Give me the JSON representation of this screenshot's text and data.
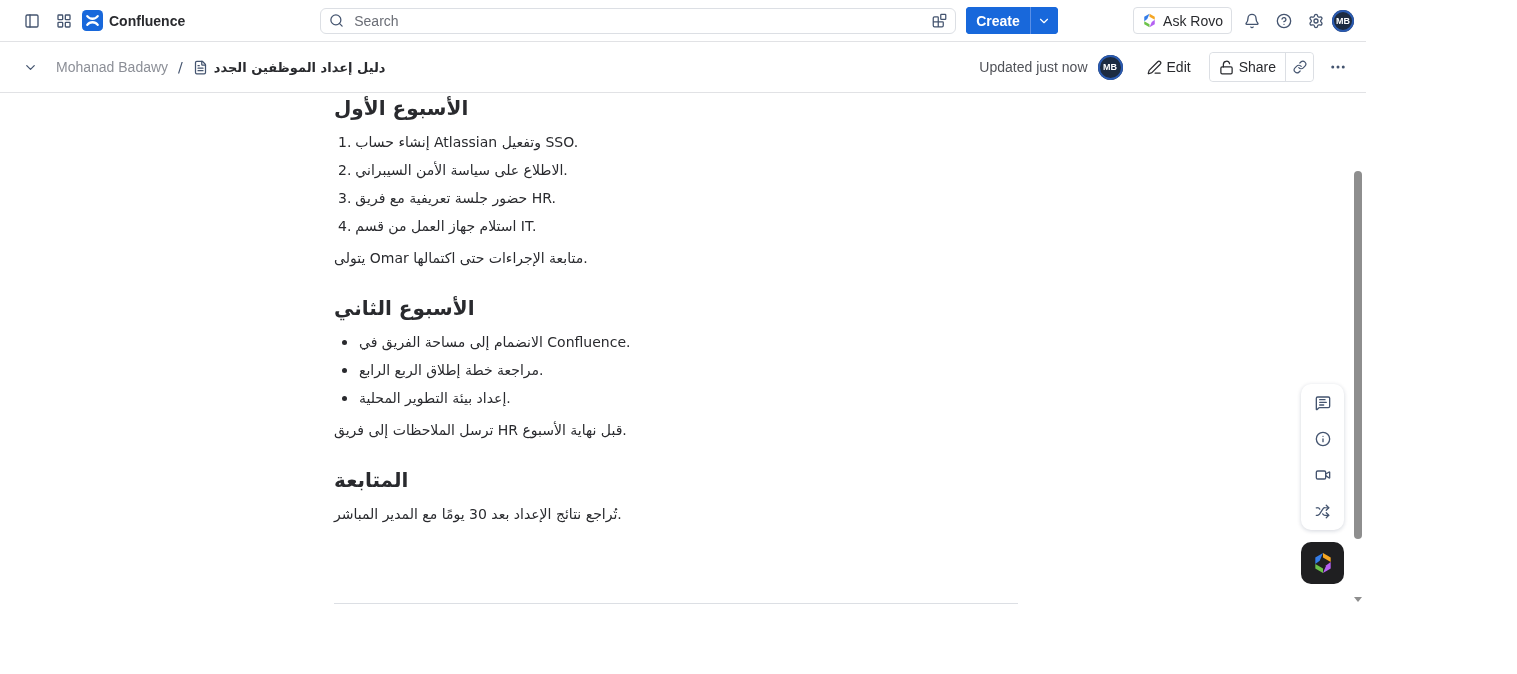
{
  "topbar": {
    "app_name": "Confluence",
    "search": {
      "placeholder": "Search"
    },
    "create_label": "Create",
    "ask_rovo_label": "Ask Rovo",
    "avatar_initials": "MB"
  },
  "page_bar": {
    "breadcrumb_space": "Mohanad Badawy",
    "breadcrumb_separator": "/",
    "page_title": "دليل إعداد الموظفين الجدد",
    "updated": "Updated just now",
    "avatar_initials": "MB",
    "edit_label": "Edit",
    "share_label": "Share"
  },
  "content": [
    {
      "kind": "heading",
      "text": "الأسبوع الأول"
    },
    {
      "kind": "ordered",
      "items": [
        {
          "marker": "1.",
          "text": "إنشاء حساب Atlassian وتفعيل SSO."
        },
        {
          "marker": "2.",
          "text": "الاطلاع على سياسة الأمن السيبراني."
        },
        {
          "marker": "3.",
          "text": "حضور جلسة تعريفية مع فريق HR."
        },
        {
          "marker": "4.",
          "text": "استلام جهاز العمل من قسم IT."
        }
      ]
    },
    {
      "kind": "paragraph",
      "text": "يتولى Omar متابعة الإجراءات حتى اكتمالها."
    },
    {
      "kind": "heading",
      "text": "الأسبوع الثاني"
    },
    {
      "kind": "bullet",
      "items": [
        {
          "text": "الانضمام إلى مساحة الفريق في Confluence."
        },
        {
          "text": "مراجعة خطة إطلاق الربع الرابع."
        },
        {
          "text": "إعداد بيئة التطوير المحلية."
        }
      ]
    },
    {
      "kind": "paragraph",
      "text": "ترسل الملاحظات إلى فريق HR قبل نهاية الأسبوع."
    },
    {
      "kind": "heading",
      "text": "المتابعة"
    },
    {
      "kind": "paragraph",
      "text": "تُراجع نتائج الإعداد بعد 30 يومًا مع المدير المباشر."
    }
  ]
}
